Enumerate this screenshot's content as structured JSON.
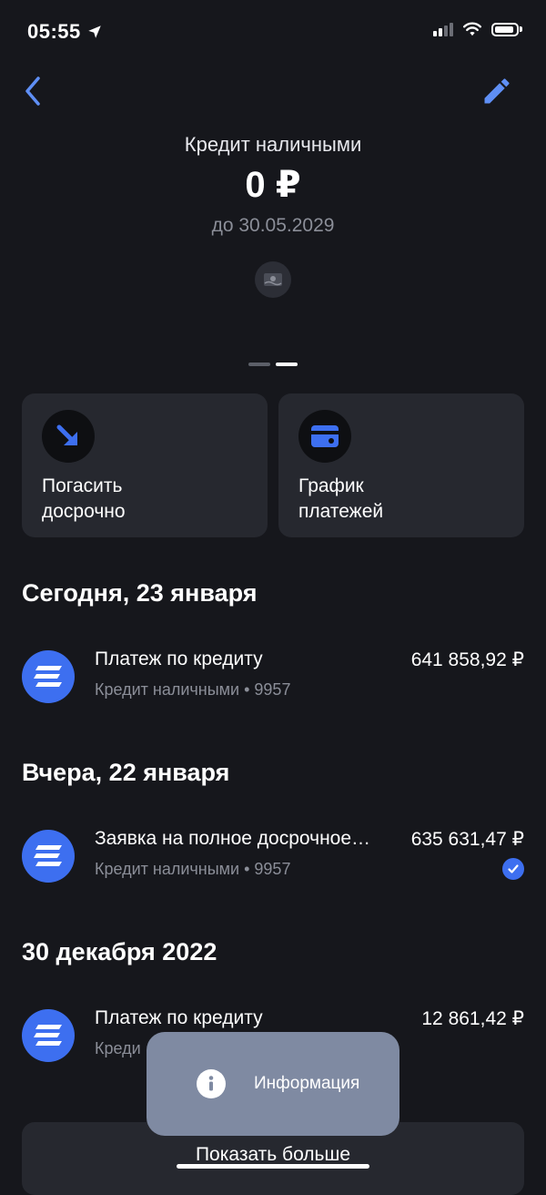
{
  "status_bar": {
    "time": "05:55"
  },
  "header": {
    "product_name": "Кредит наличными",
    "balance": "0 ₽",
    "due_date": "до 30.05.2029"
  },
  "actions": [
    {
      "label": "Погасить\nдосрочно",
      "icon": "arrow-down-right-icon"
    },
    {
      "label": "График\nплатежей",
      "icon": "card-icon"
    }
  ],
  "sections": [
    {
      "title": "Сегодня, 23 января",
      "transactions": [
        {
          "title": "Платеж по кредиту",
          "subtitle": "Кредит наличными • 9957",
          "amount": "641 858,92 ₽"
        }
      ]
    },
    {
      "title": "Вчера, 22 января",
      "transactions": [
        {
          "title": "Заявка на полное досрочное…",
          "subtitle": "Кредит наличными • 9957",
          "amount": "635 631,47 ₽",
          "status": "check-icon"
        }
      ]
    },
    {
      "title": "30 декабря 2022",
      "transactions": [
        {
          "title": "Платеж по кредиту",
          "subtitle": "Креди",
          "amount": "12 861,42 ₽"
        }
      ]
    }
  ],
  "show_more_label": "Показать больше",
  "toast": {
    "text": "Информация",
    "icon": "info-icon"
  },
  "colors": {
    "background": "#16171c",
    "card": "#26282f",
    "accent": "#3d6ff0",
    "toast": "#7f8aa2"
  }
}
